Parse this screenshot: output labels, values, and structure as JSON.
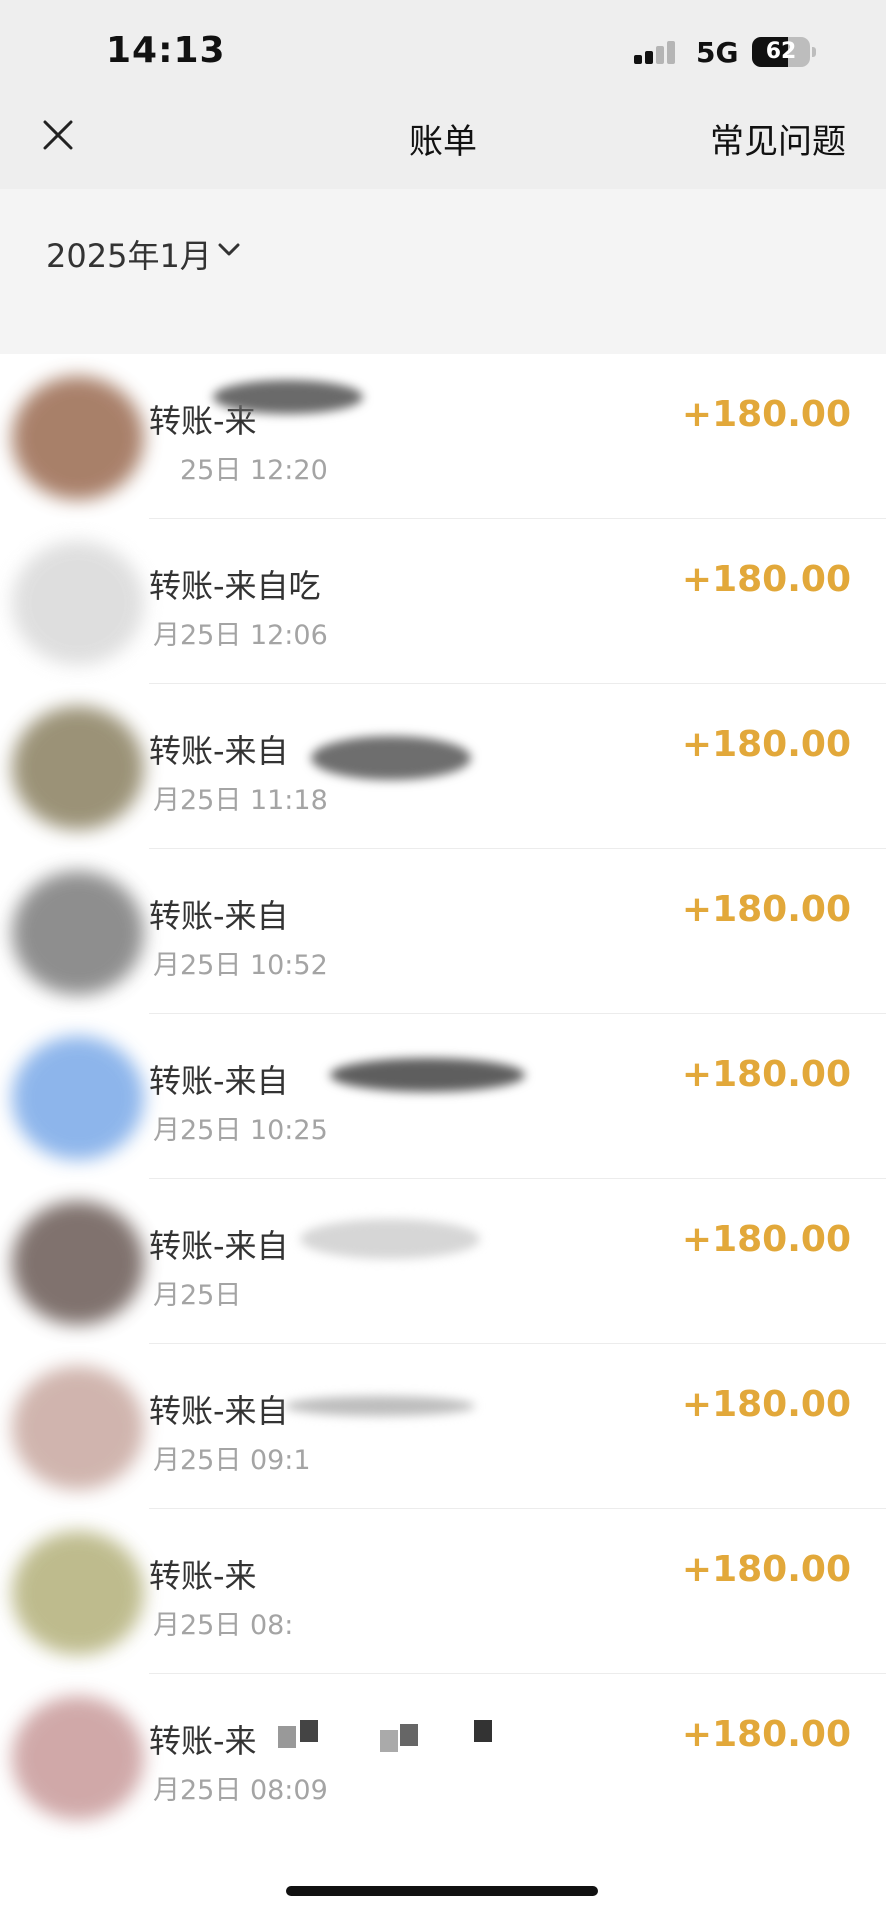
{
  "status_bar": {
    "time": "14:13",
    "network": "5G",
    "battery": "62",
    "signal_icon": "cellular-signal-icon",
    "battery_icon": "battery-icon"
  },
  "header": {
    "title": "账单",
    "faq_label": "常见问题",
    "close_icon": "close-icon"
  },
  "filter": {
    "month_label": "2025年1月",
    "chevron_icon": "chevron-down-icon"
  },
  "transactions": [
    {
      "title": "转账-来",
      "date": "25日 12:20",
      "amount": "+180.00"
    },
    {
      "title": "转账-来自吃",
      "date": "月25日 12:06",
      "amount": "+180.00"
    },
    {
      "title": "转账-来自",
      "date": "月25日 11:18",
      "amount": "+180.00"
    },
    {
      "title": "转账-来自",
      "date": "月25日 10:52",
      "amount": "+180.00"
    },
    {
      "title": "转账-来自",
      "date": "月25日 10:25",
      "amount": "+180.00"
    },
    {
      "title": "转账-来自",
      "date": "月25日",
      "amount": "+180.00"
    },
    {
      "title": "转账-来自",
      "date": "月25日 09:1",
      "amount": "+180.00"
    },
    {
      "title": "转账-来",
      "date": "月25日 08:",
      "amount": "+180.00"
    },
    {
      "title": "转账-来",
      "date": "月25日 08:09",
      "amount": "+180.00"
    }
  ],
  "colors": {
    "amount": "#e2a83a",
    "header_background": "#eeeeee",
    "list_background": "#ffffff"
  }
}
